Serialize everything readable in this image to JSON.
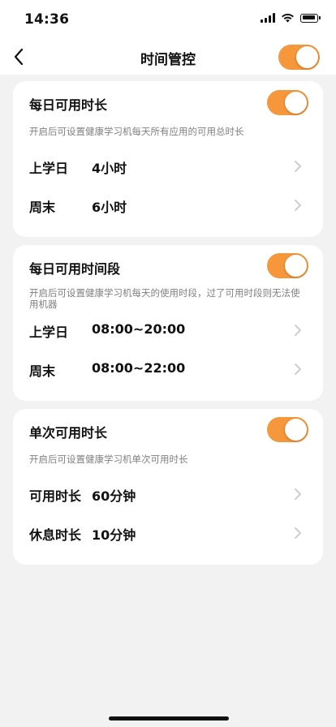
{
  "status_bar": {
    "time": "14:36",
    "icons": [
      "cellular-signal-icon",
      "wifi-icon",
      "battery-icon"
    ]
  },
  "nav": {
    "title": "时间管控",
    "back_icon": "chevron-left-icon",
    "master_toggle_on": true
  },
  "colors": {
    "accent": "#f5973a",
    "background": "#f2f2f2",
    "card": "#ffffff",
    "secondary_text": "#808080",
    "chevron": "#c7c7cc"
  },
  "sections": [
    {
      "title": "每日可用时长",
      "toggle_on": true,
      "description": "开启后可设置健康学习机每天所有应用的可用总时长",
      "rows": [
        {
          "label": "上学日",
          "value": "4小时"
        },
        {
          "label": "周末",
          "value": "6小时"
        }
      ]
    },
    {
      "title": "每日可用时间段",
      "toggle_on": true,
      "description": "开启后可设置健康学习机每天的使用时段，过了可用时段则无法使用机器",
      "rows": [
        {
          "label": "上学日",
          "value": "08:00~20:00"
        },
        {
          "label": "周末",
          "value": "08:00~22:00"
        }
      ]
    },
    {
      "title": "单次可用时长",
      "toggle_on": true,
      "description": "开启后可设置健康学习机单次可用时长",
      "rows": [
        {
          "label": "可用时长",
          "value": "60分钟"
        },
        {
          "label": "休息时长",
          "value": "10分钟"
        }
      ]
    }
  ]
}
